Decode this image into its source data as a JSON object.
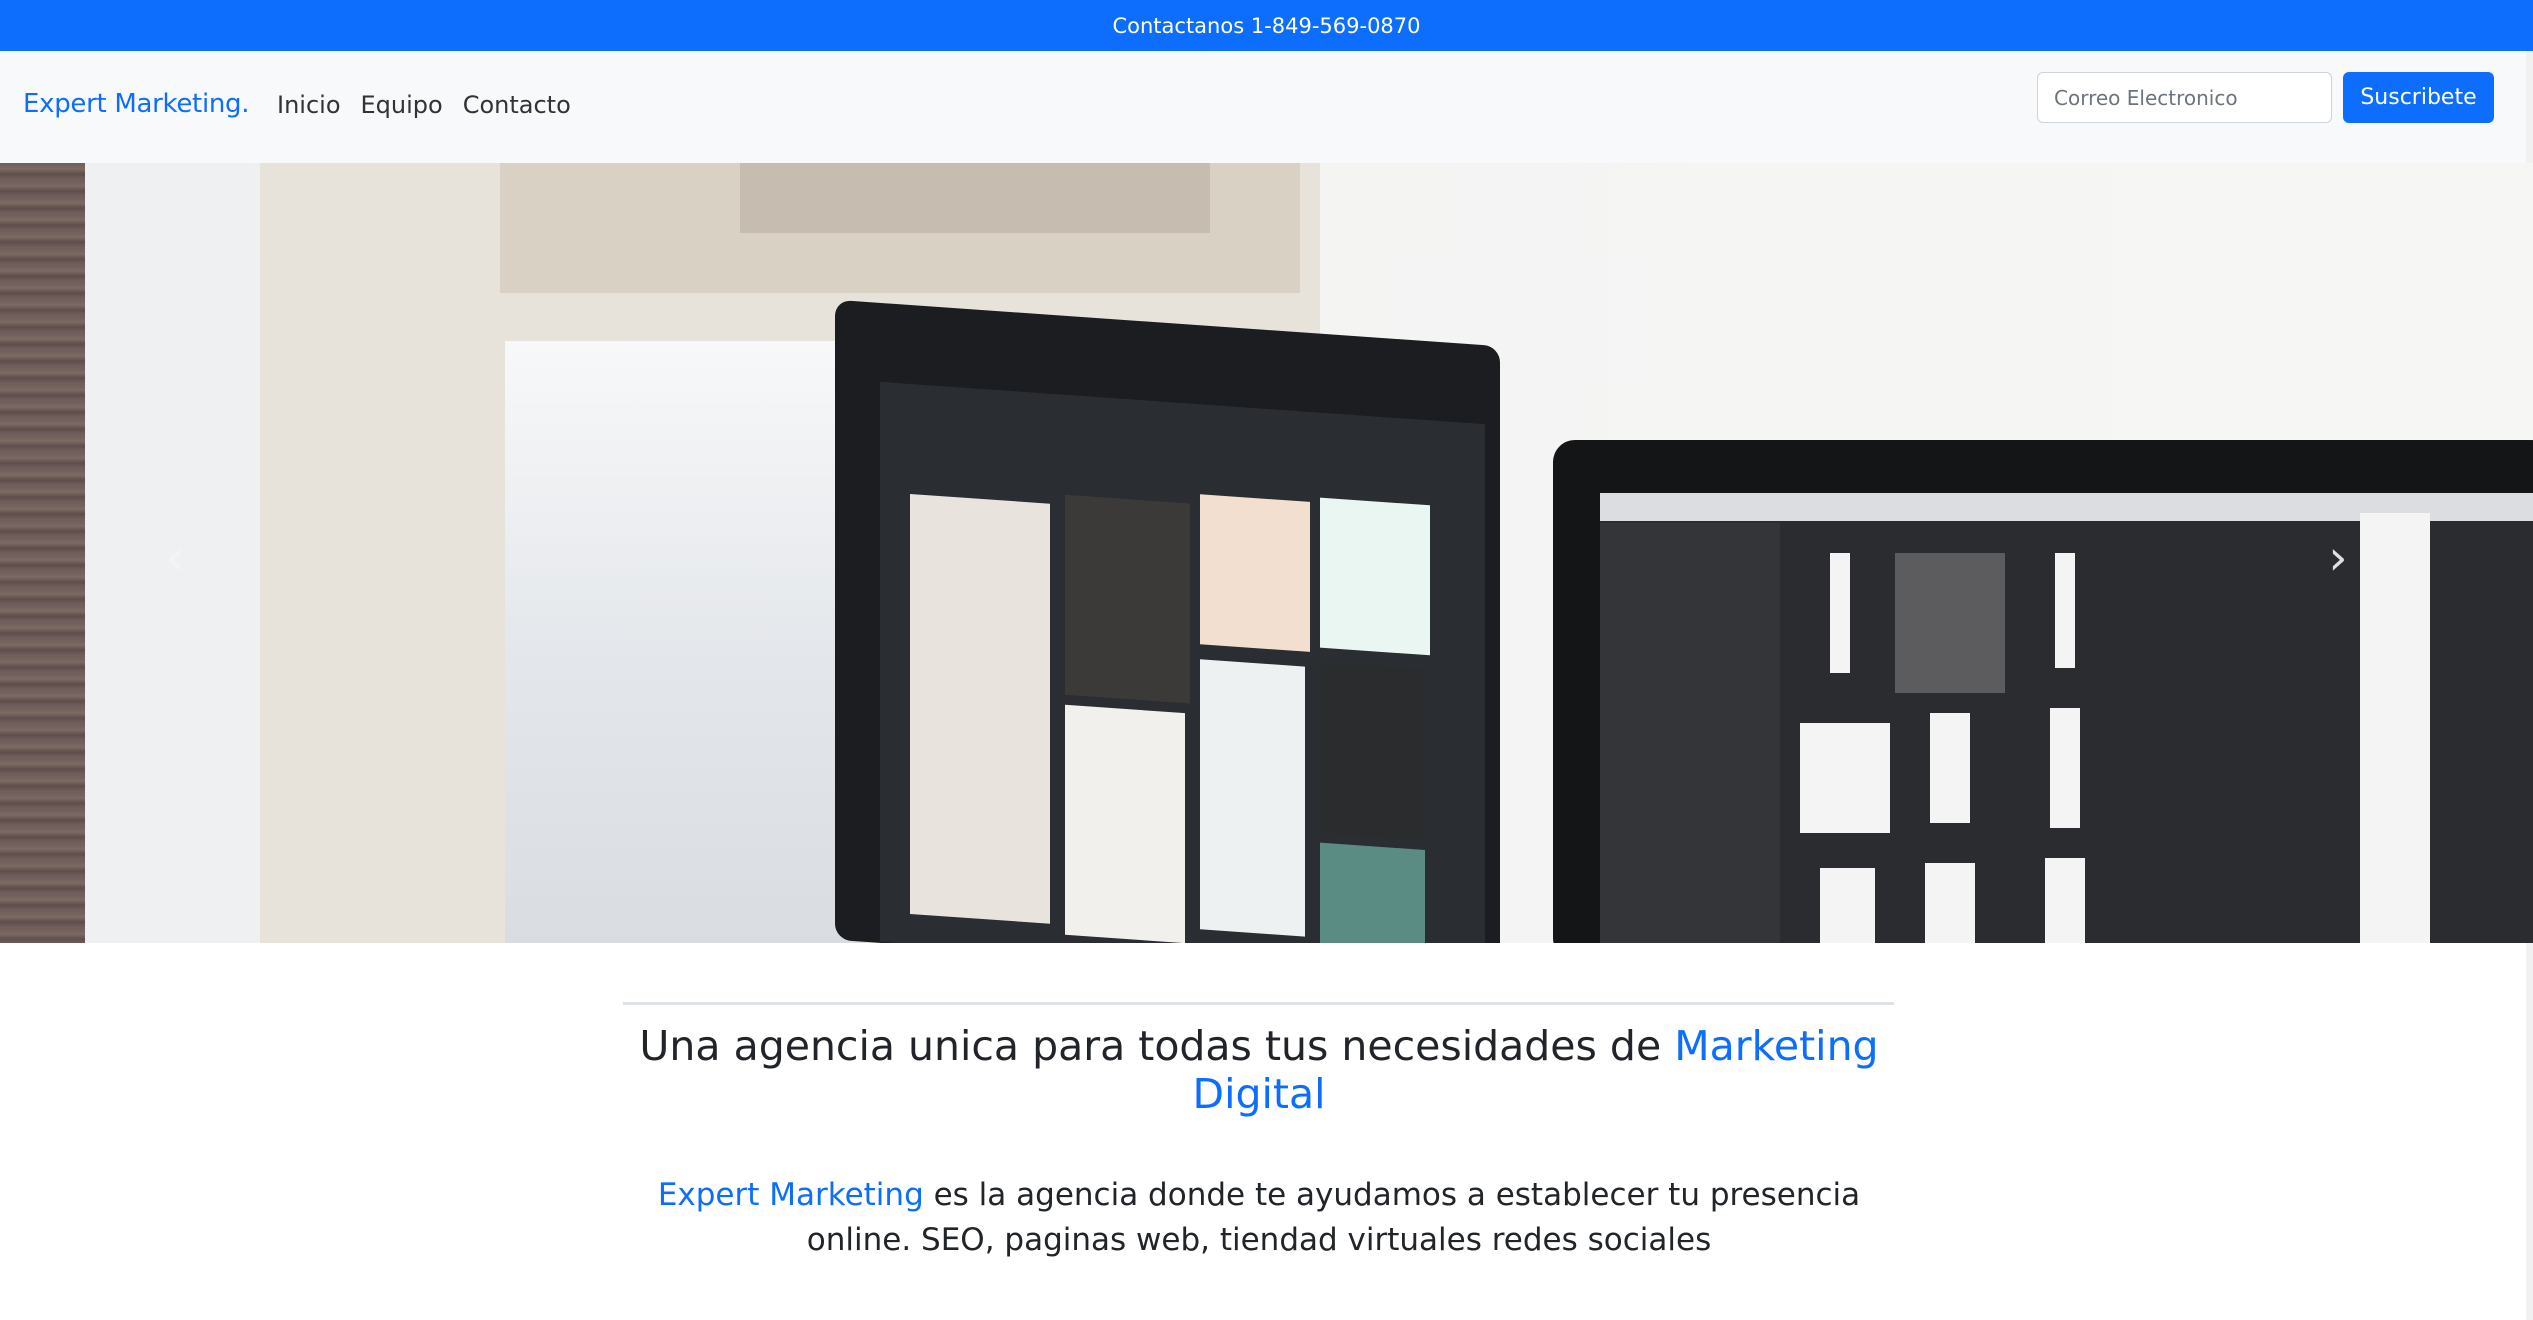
{
  "topbar": {
    "contact_text": "Contactanos 1-849-569-0870"
  },
  "navbar": {
    "brand": "Expert Marketing.",
    "links": [
      {
        "label": "Inicio"
      },
      {
        "label": "Equipo"
      },
      {
        "label": "Contacto"
      }
    ],
    "email_placeholder": "Correo Electronico",
    "email_value": "",
    "subscribe_label": "Suscribete"
  },
  "hero": {
    "prev_icon": "chevron-left-icon",
    "next_icon": "chevron-right-icon",
    "prev_glyph": "‹",
    "next_glyph": "›"
  },
  "intro": {
    "headline_prefix": "Una agencia unica para todas tus necesidades de",
    "headline_accent": "Marketing Digital",
    "lead_accent": "Expert Marketing",
    "lead_rest": "es la agencia donde te ayudamos a establecer tu presencia online. SEO, paginas web, tiendad virtuales redes sociales"
  },
  "colors": {
    "primary": "#0d6efd",
    "navbar_bg": "#f8f9fa",
    "text": "#212529"
  }
}
